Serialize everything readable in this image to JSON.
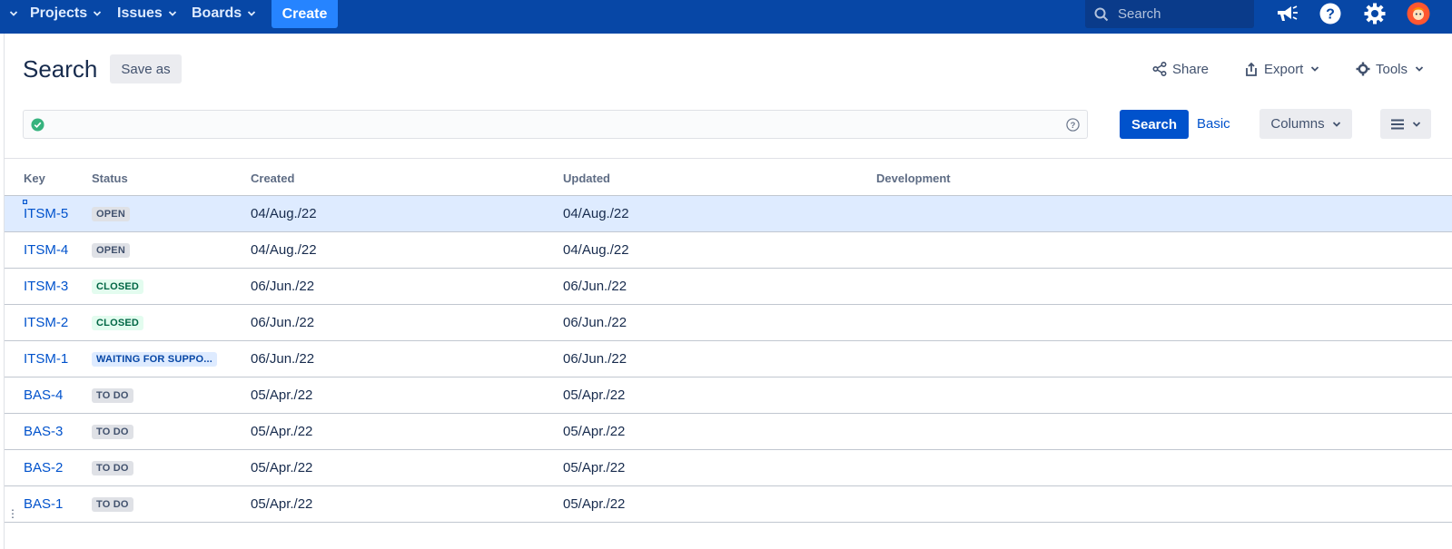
{
  "nav": {
    "items": [
      {
        "label": "Projects"
      },
      {
        "label": "Issues"
      },
      {
        "label": "Boards"
      }
    ],
    "create_label": "Create",
    "search_placeholder": "Search"
  },
  "header": {
    "title": "Search",
    "save_as": "Save as",
    "share": "Share",
    "export": "Export",
    "tools": "Tools"
  },
  "query": {
    "search_button": "Search",
    "basic_link": "Basic",
    "columns_button": "Columns"
  },
  "table": {
    "columns": [
      "Key",
      "Status",
      "Created",
      "Updated",
      "Development"
    ],
    "rows": [
      {
        "key": "ITSM-5",
        "status": "OPEN",
        "status_color": "grey",
        "created": "04/Aug./22",
        "updated": "04/Aug./22",
        "selected": true
      },
      {
        "key": "ITSM-4",
        "status": "OPEN",
        "status_color": "grey",
        "created": "04/Aug./22",
        "updated": "04/Aug./22"
      },
      {
        "key": "ITSM-3",
        "status": "CLOSED",
        "status_color": "green",
        "created": "06/Jun./22",
        "updated": "06/Jun./22"
      },
      {
        "key": "ITSM-2",
        "status": "CLOSED",
        "status_color": "green",
        "created": "06/Jun./22",
        "updated": "06/Jun./22"
      },
      {
        "key": "ITSM-1",
        "status": "WAITING FOR SUPPO...",
        "status_color": "blue",
        "created": "06/Jun./22",
        "updated": "06/Jun./22"
      },
      {
        "key": "BAS-4",
        "status": "TO DO",
        "status_color": "grey",
        "created": "05/Apr./22",
        "updated": "05/Apr./22"
      },
      {
        "key": "BAS-3",
        "status": "TO DO",
        "status_color": "grey",
        "created": "05/Apr./22",
        "updated": "05/Apr./22"
      },
      {
        "key": "BAS-2",
        "status": "TO DO",
        "status_color": "grey",
        "created": "05/Apr./22",
        "updated": "05/Apr./22"
      },
      {
        "key": "BAS-1",
        "status": "TO DO",
        "status_color": "grey",
        "created": "05/Apr./22",
        "updated": "05/Apr./22"
      }
    ]
  },
  "colors": {
    "nav_bg": "#0747a6",
    "primary": "#0052cc",
    "selected_row": "#deebff",
    "success": "#36b37e"
  },
  "icons": [
    "chevron-down-icon",
    "search-icon",
    "megaphone-icon",
    "help-icon",
    "gear-icon",
    "avatar",
    "share-icon",
    "export-icon",
    "cog-icon",
    "check-circle-icon",
    "question-circle-icon",
    "list-menu-icon"
  ]
}
